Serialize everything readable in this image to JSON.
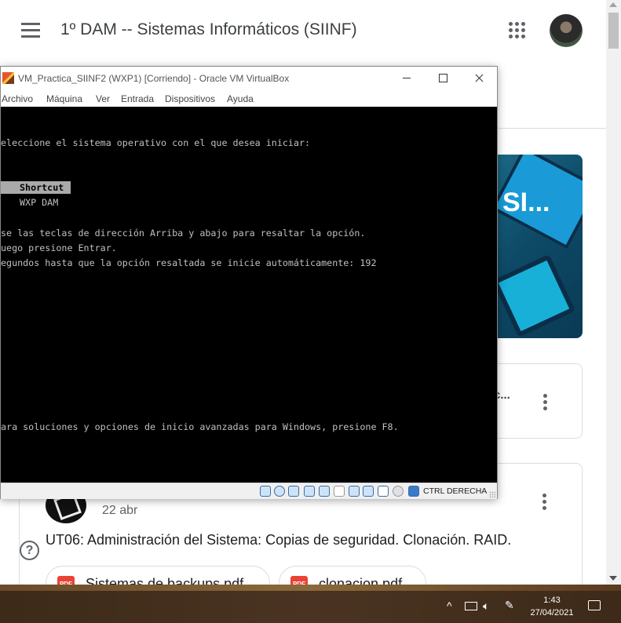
{
  "classroom": {
    "title": "1º DAM -- Sistemas Informáticos (SIINF)",
    "banner_text": "SI...",
    "card1_title": "c...",
    "post": {
      "date": "22 abr",
      "title": "UT06: Administración del Sistema: Copias de seguridad. Clonación. RAID.",
      "attachments": [
        {
          "icon_label": "PDF",
          "name": "Sistemas de backups.pdf"
        },
        {
          "icon_label": "PDF",
          "name": "clonacion.pdf"
        }
      ]
    },
    "help_label": "?"
  },
  "vbox": {
    "title": "VM_Practica_SIINF2 (WXP1) [Corriendo] - Oracle VM VirtualBox",
    "menu": [
      "Archivo",
      "Máquina",
      "Ver",
      "Entrada",
      "Dispositivos",
      "Ayuda"
    ],
    "screen": {
      "line_header": "eleccione el sistema operativo con el que desea iniciar:",
      "option_selected": "Shortcut",
      "option_2": "WXP DAM",
      "line_keys": "se las teclas de dirección Arriba y abajo para resaltar la opción.",
      "line_enter": "uego presione Entrar.",
      "line_timer": "egundos hasta que la opción resaltada se inicie automáticamente: 192",
      "line_f8": "ara soluciones y opciones de inicio avanzadas para Windows, presione F8."
    },
    "status_icons": [
      "hard-disk-icon",
      "optical-drive-icon",
      "audio-icon",
      "network-icon",
      "usb-icon",
      "shared-folders-icon",
      "display-icon",
      "recording-icon",
      "vt-x-icon",
      "mouse-integration-icon",
      "keyboard-icon"
    ],
    "host_key": "CTRL DERECHA"
  },
  "taskbar": {
    "time": "1:43",
    "date": "27/04/2021",
    "tray_chevron": "^"
  }
}
